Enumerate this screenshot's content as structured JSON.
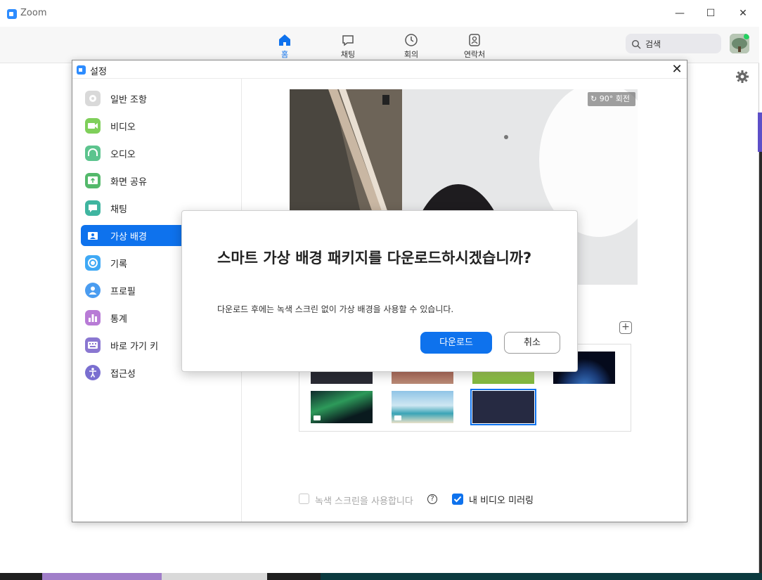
{
  "app": {
    "title": "Zoom"
  },
  "window_controls": {
    "minimize": "—",
    "maximize": "☐",
    "close": "✕"
  },
  "nav": {
    "tabs": [
      {
        "label": "홈",
        "icon": "home-icon",
        "active": true
      },
      {
        "label": "채팅",
        "icon": "chat-bubble-icon",
        "active": false
      },
      {
        "label": "회의",
        "icon": "clock-icon",
        "active": false
      },
      {
        "label": "연락처",
        "icon": "contact-card-icon",
        "active": false
      }
    ],
    "search": {
      "placeholder": "검색",
      "icon": "search-icon"
    }
  },
  "settings": {
    "title": "설정",
    "close": "✕",
    "sidebar": {
      "items": [
        {
          "label": "일반 조항",
          "icon": "gear-icon",
          "color": "#d9d9d9"
        },
        {
          "label": "비디오",
          "icon": "video-camera-icon",
          "color": "#7fcf5a"
        },
        {
          "label": "오디오",
          "icon": "headphones-icon",
          "color": "#5cc48e"
        },
        {
          "label": "화면 공유",
          "icon": "screen-share-icon",
          "color": "#54b96b"
        },
        {
          "label": "채팅",
          "icon": "chat-bubble-icon",
          "color": "#3fb5a0"
        },
        {
          "label": "가상 배경",
          "icon": "virtual-background-icon",
          "color": "#0e72ed",
          "active": true
        },
        {
          "label": "기록",
          "icon": "record-icon",
          "color": "#3fa9f5"
        },
        {
          "label": "프로필",
          "icon": "profile-icon",
          "color": "#4a9cf0"
        },
        {
          "label": "통계",
          "icon": "bar-chart-icon",
          "color": "#b87bd6"
        },
        {
          "label": "바로 가기 키",
          "icon": "keyboard-icon",
          "color": "#8a77d1"
        },
        {
          "label": "접근성",
          "icon": "accessibility-icon",
          "color": "#7a6fd0"
        }
      ]
    },
    "video_preview": {
      "rotate_label": "90° 회전"
    },
    "add_background": "+",
    "options": {
      "green_screen_label": "녹색 스크린을 사용합니다",
      "green_screen_checked": false,
      "help": "?",
      "mirror_label": "내 비디오 미러링",
      "mirror_checked": true
    }
  },
  "modal": {
    "title": "스마트 가상 배경 패키지를 다운로드하시겠습니까?",
    "message": "다운로드 후에는 녹색 스크린 없이 가상 배경을 사용할 수 있습니다.",
    "download_label": "다운로드",
    "cancel_label": "취소",
    "accent": "#0e72ed"
  }
}
